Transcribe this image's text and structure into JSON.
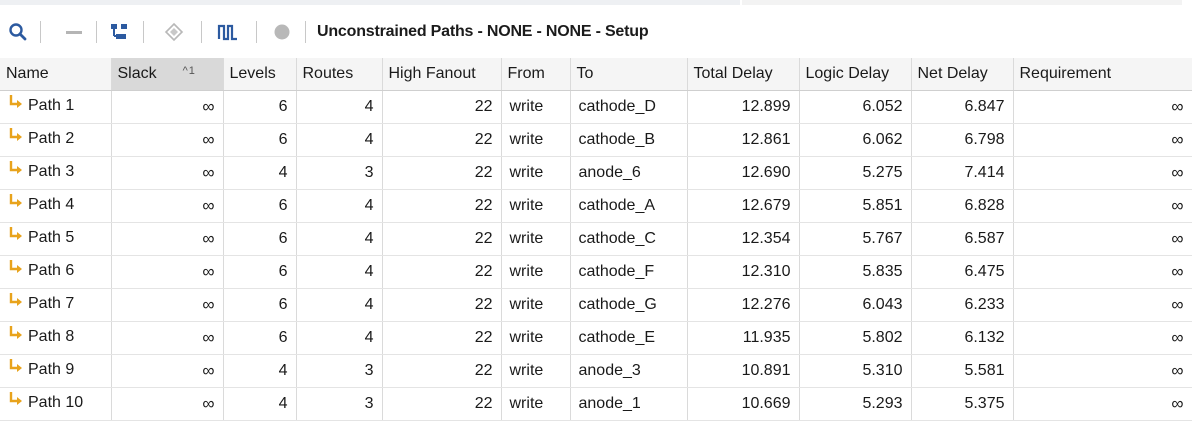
{
  "toolbar": {
    "title": "Unconstrained Paths - NONE - NONE - Setup",
    "icons": [
      "search-icon",
      "collapse-icon",
      "hierarchy-icon",
      "diamond-icon",
      "waveform-icon",
      "circle-icon"
    ]
  },
  "colors": {
    "header_bg": "#f5f5f5",
    "sorted_header_bg": "#d9d9d9",
    "path_icon": "#e8a31c"
  },
  "table": {
    "columns": [
      {
        "label": "Name",
        "sort": ""
      },
      {
        "label": "Slack",
        "sort": "^1"
      },
      {
        "label": "Levels",
        "sort": ""
      },
      {
        "label": "Routes",
        "sort": ""
      },
      {
        "label": "High Fanout",
        "sort": ""
      },
      {
        "label": "From",
        "sort": ""
      },
      {
        "label": "To",
        "sort": ""
      },
      {
        "label": "Total Delay",
        "sort": ""
      },
      {
        "label": "Logic Delay",
        "sort": ""
      },
      {
        "label": "Net Delay",
        "sort": ""
      },
      {
        "label": "Requirement",
        "sort": ""
      }
    ],
    "rows": [
      {
        "name": "Path 1",
        "slack": "∞",
        "levels": "6",
        "routes": "4",
        "fanout": "22",
        "from": "write",
        "to": "cathode_D",
        "total": "12.899",
        "logic": "6.052",
        "net": "6.847",
        "req": "∞"
      },
      {
        "name": "Path 2",
        "slack": "∞",
        "levels": "6",
        "routes": "4",
        "fanout": "22",
        "from": "write",
        "to": "cathode_B",
        "total": "12.861",
        "logic": "6.062",
        "net": "6.798",
        "req": "∞"
      },
      {
        "name": "Path 3",
        "slack": "∞",
        "levels": "4",
        "routes": "3",
        "fanout": "22",
        "from": "write",
        "to": "anode_6",
        "total": "12.690",
        "logic": "5.275",
        "net": "7.414",
        "req": "∞"
      },
      {
        "name": "Path 4",
        "slack": "∞",
        "levels": "6",
        "routes": "4",
        "fanout": "22",
        "from": "write",
        "to": "cathode_A",
        "total": "12.679",
        "logic": "5.851",
        "net": "6.828",
        "req": "∞"
      },
      {
        "name": "Path 5",
        "slack": "∞",
        "levels": "6",
        "routes": "4",
        "fanout": "22",
        "from": "write",
        "to": "cathode_C",
        "total": "12.354",
        "logic": "5.767",
        "net": "6.587",
        "req": "∞"
      },
      {
        "name": "Path 6",
        "slack": "∞",
        "levels": "6",
        "routes": "4",
        "fanout": "22",
        "from": "write",
        "to": "cathode_F",
        "total": "12.310",
        "logic": "5.835",
        "net": "6.475",
        "req": "∞"
      },
      {
        "name": "Path 7",
        "slack": "∞",
        "levels": "6",
        "routes": "4",
        "fanout": "22",
        "from": "write",
        "to": "cathode_G",
        "total": "12.276",
        "logic": "6.043",
        "net": "6.233",
        "req": "∞"
      },
      {
        "name": "Path 8",
        "slack": "∞",
        "levels": "6",
        "routes": "4",
        "fanout": "22",
        "from": "write",
        "to": "cathode_E",
        "total": "11.935",
        "logic": "5.802",
        "net": "6.132",
        "req": "∞"
      },
      {
        "name": "Path 9",
        "slack": "∞",
        "levels": "4",
        "routes": "3",
        "fanout": "22",
        "from": "write",
        "to": "anode_3",
        "total": "10.891",
        "logic": "5.310",
        "net": "5.581",
        "req": "∞"
      },
      {
        "name": "Path 10",
        "slack": "∞",
        "levels": "4",
        "routes": "3",
        "fanout": "22",
        "from": "write",
        "to": "anode_1",
        "total": "10.669",
        "logic": "5.293",
        "net": "5.375",
        "req": "∞"
      }
    ]
  }
}
